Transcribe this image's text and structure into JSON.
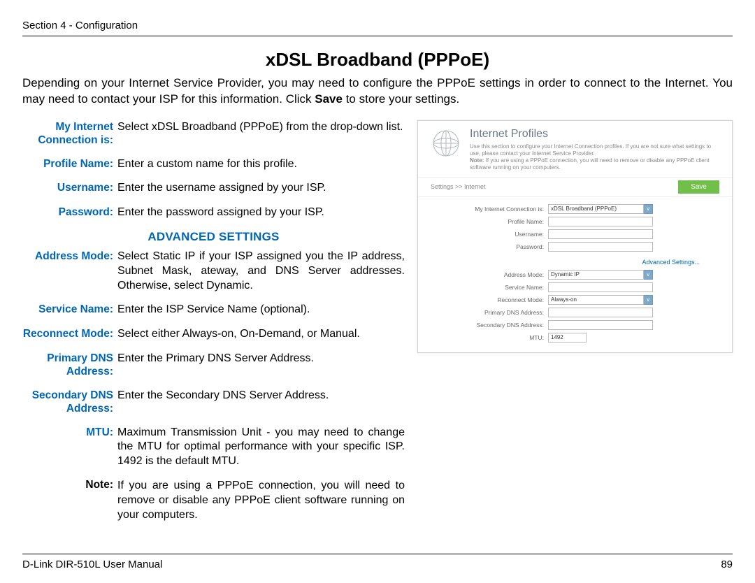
{
  "header": {
    "section": "Section 4 - Configuration"
  },
  "title": "xDSL Broadband (PPPoE)",
  "intro_a": "Depending on your Internet Service Provider, you may need to configure the PPPoE settings in order to connect to the Internet. You may need to contact your ISP for this information. Click ",
  "intro_bold": "Save",
  "intro_b": " to store your settings.",
  "defs": {
    "conn_lbl": "My Internet Connection is:",
    "conn_val": "Select xDSL Broadband (PPPoE) from the drop-down list.",
    "prof_lbl": "Profile Name:",
    "prof_val": "Enter a custom name for this profile.",
    "user_lbl": "Username:",
    "user_val": "Enter the username assigned by your ISP.",
    "pass_lbl": "Password:",
    "pass_val": "Enter the password assigned by your ISP.",
    "adv_hdr": "ADVANCED SETTINGS",
    "addr_lbl": "Address Mode:",
    "addr_val": "Select Static IP if your ISP assigned you the IP address, Subnet Mask, ateway, and DNS Server addresses. Otherwise, select Dynamic.",
    "svc_lbl": "Service Name:",
    "svc_val": "Enter the ISP Service Name (optional).",
    "recon_lbl": "Reconnect Mode:",
    "recon_val": "Select either Always-on, On-Demand, or Manual.",
    "pdns_lbl": "Primary DNS Address:",
    "pdns_val": "Enter the Primary DNS Server Address.",
    "sdns_lbl": "Secondary DNS Address:",
    "sdns_val": "Enter the Secondary DNS Server Address.",
    "mtu_lbl": "MTU:",
    "mtu_val": "Maximum Transmission Unit - you may need to change the MTU for optimal performance with your specific ISP. 1492 is the default MTU."
  },
  "note_lbl": "Note:",
  "note_val": "If you are using a PPPoE connection, you will need to remove or disable any PPPoE client software running on your computers.",
  "footer": {
    "left": "D-Link DIR-510L User Manual",
    "right": "89"
  },
  "shot": {
    "title": "Internet Profiles",
    "desc1": "Use this section to configure your Internet Connection profiles. If you are not sure what settings to use, please contact your Internet Service Provider.",
    "desc2_a": "Note:",
    "desc2_b": " If you are using a PPPoE connection, you will need to remove or disable any PPPoE client software running on your computers.",
    "breadcrumb": "Settings >> Internet",
    "save": "Save",
    "conn_lbl": "My Internet Connection is:",
    "conn_val": "xDSL Broadband (PPPoE)",
    "profile_lbl": "Profile Name:",
    "user_lbl": "Username:",
    "pass_lbl": "Password:",
    "adv_link": "Advanced Settings...",
    "addr_lbl": "Address Mode:",
    "addr_val": "Dynamic IP",
    "svc_lbl": "Service Name:",
    "recon_lbl": "Reconnect Mode:",
    "recon_val": "Always-on",
    "pdns_lbl": "Primary DNS Address:",
    "sdns_lbl": "Secondary DNS Address:",
    "mtu_lbl": "MTU:",
    "mtu_val": "1492"
  }
}
